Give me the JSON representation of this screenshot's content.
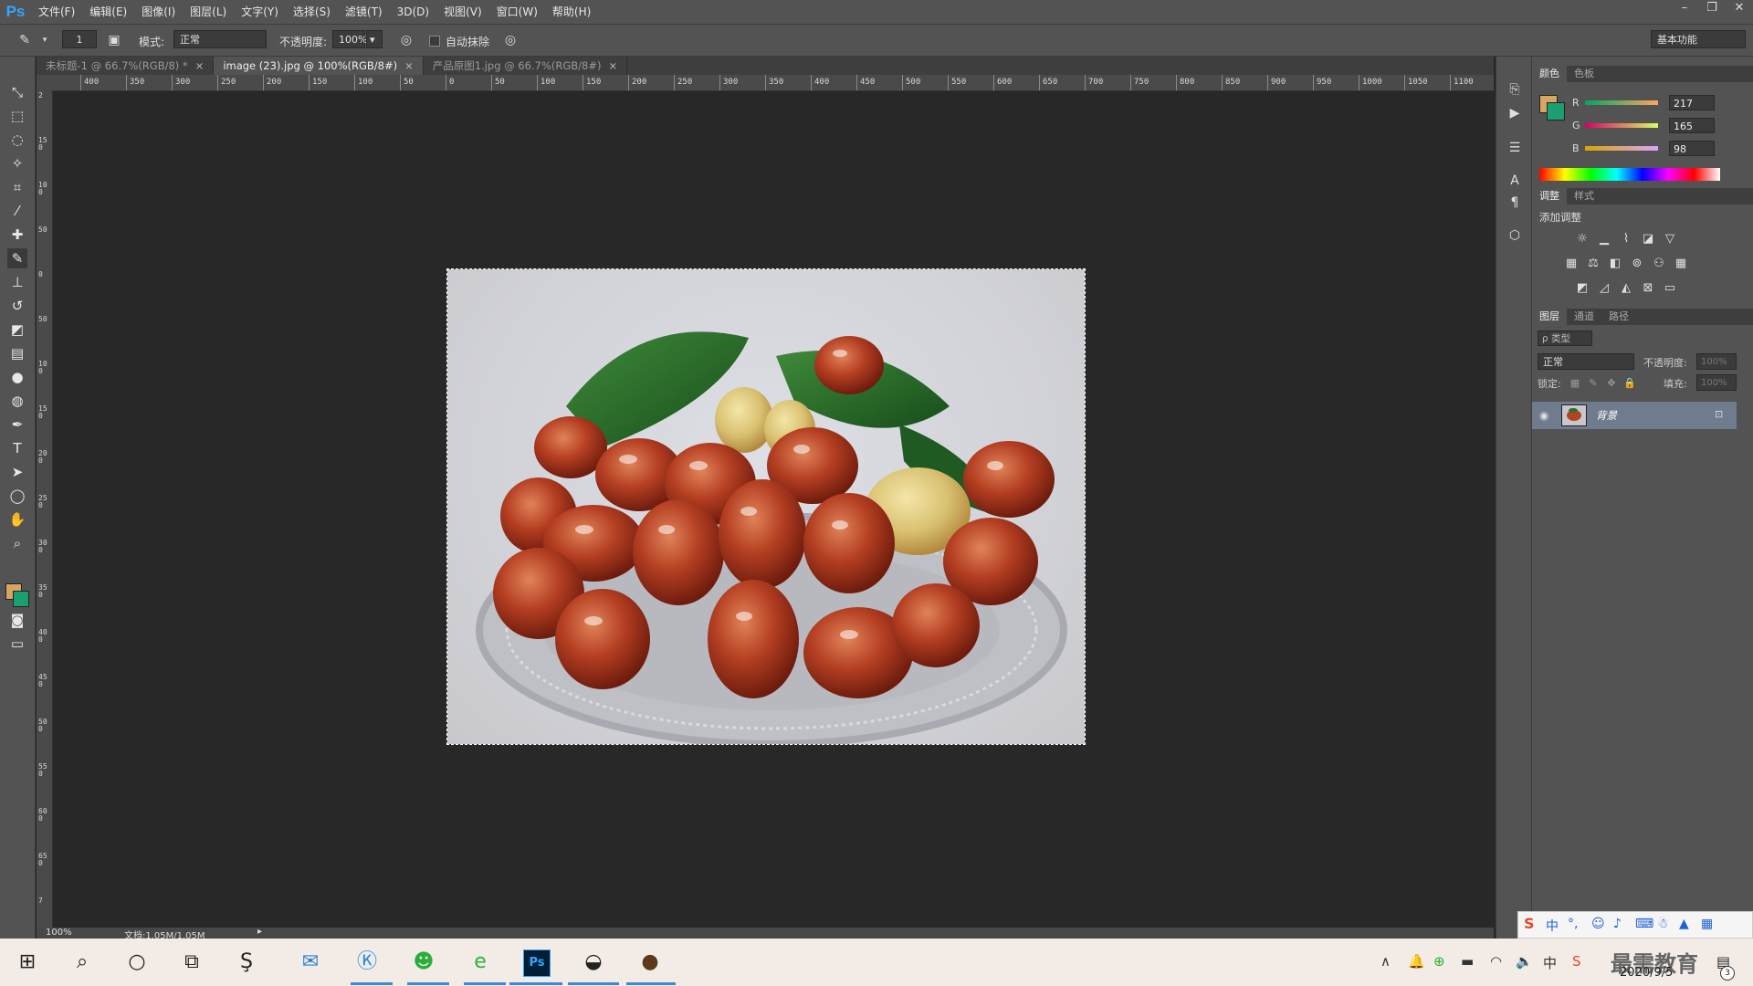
{
  "app": {
    "logo": "Ps"
  },
  "menu": [
    "文件(F)",
    "编辑(E)",
    "图像(I)",
    "图层(L)",
    "文字(Y)",
    "选择(S)",
    "滤镜(T)",
    "3D(D)",
    "视图(V)",
    "窗口(W)",
    "帮助(H)"
  ],
  "window_controls": {
    "minimize": "–",
    "restore": "❐",
    "close": "✕"
  },
  "options": {
    "brush_size": "1",
    "mode_label": "模式:",
    "mode_value": "正常",
    "opacity_label": "不透明度:",
    "opacity_value": "100%",
    "auto_erase_label": "自动抹除",
    "workspace": "基本功能"
  },
  "tabs": [
    {
      "label": "未标题-1 @ 66.7%(RGB/8) *",
      "close": "×"
    },
    {
      "label": "image (23).jpg @ 100%(RGB/8#)",
      "close": "×"
    },
    {
      "label": "产品原图1.jpg @ 66.7%(RGB/8#)",
      "close": "×"
    }
  ],
  "ruler_h": [
    "400",
    "350",
    "300",
    "250",
    "200",
    "150",
    "100",
    "50",
    "0",
    "50",
    "100",
    "150",
    "200",
    "250",
    "300",
    "350",
    "400",
    "450",
    "500",
    "550",
    "600",
    "650",
    "700",
    "750",
    "800",
    "850",
    "900",
    "950",
    "1000",
    "1050",
    "1100"
  ],
  "ruler_v": [
    "2",
    "1\n5\n0",
    "1\n0\n0",
    "5\n0",
    "0",
    "5\n0",
    "1\n0\n0",
    "1\n5\n0",
    "2\n0\n0",
    "2\n5\n0",
    "3\n0\n0",
    "3\n5\n0",
    "4\n0\n0",
    "4\n5\n0",
    "5\n0\n0",
    "5\n5\n0",
    "6\n0\n0",
    "6\n5\n0",
    "7"
  ],
  "status": {
    "zoom": "100%",
    "doc": "文档:1.05M/1.05M"
  },
  "colors": {
    "foreground": "#d9a562",
    "background": "#1aa070",
    "tabs": [
      "颜色",
      "色板"
    ],
    "r_label": "R",
    "r_value": "217",
    "g_label": "G",
    "g_value": "165",
    "b_label": "B",
    "b_value": "98"
  },
  "adjustments": {
    "tabs": [
      "调整",
      "样式"
    ],
    "title": "添加调整"
  },
  "layers": {
    "tabs": [
      "图层",
      "通道",
      "路径"
    ],
    "filter": "ρ 类型",
    "blend": "正常",
    "opacity_label": "不透明度:",
    "opacity_value": "100%",
    "lock_label": "锁定:",
    "fill_label": "填充:",
    "fill_value": "100%",
    "layer_name": "背景"
  },
  "taskbar": {
    "date": "2020/9/5",
    "ime_chinese": "中",
    "watermark": "最需教育",
    "notification_count": "3"
  }
}
